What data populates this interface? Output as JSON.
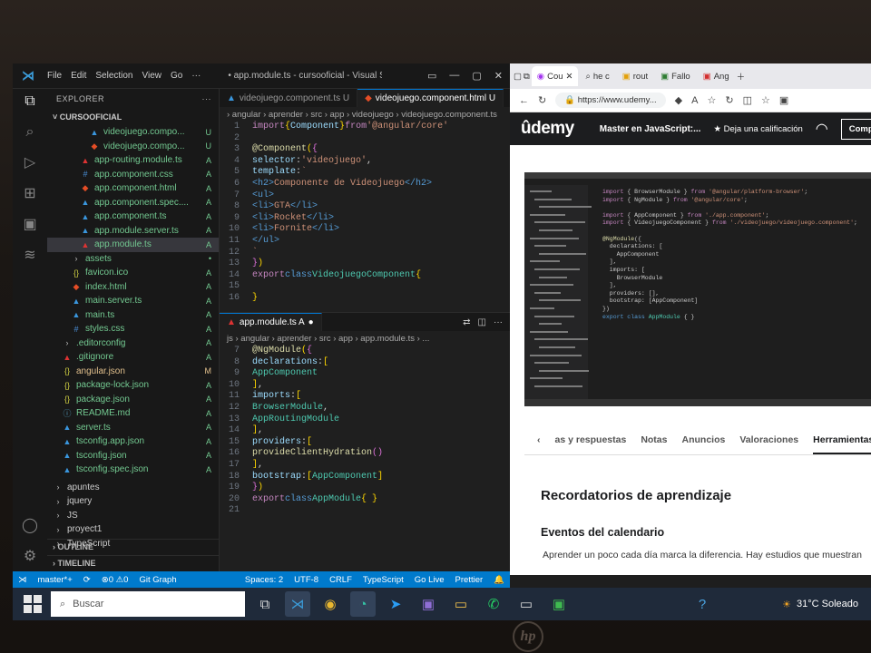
{
  "vscode": {
    "menu": [
      "File",
      "Edit",
      "Selection",
      "View",
      "Go",
      "···"
    ],
    "window_title": "• app.module.ts - cursooficial - Visual Stu...",
    "explorer_label": "EXPLORER",
    "project": "CURSOOFICIAL",
    "files": [
      {
        "name": "videojuego.compo...",
        "status": "U",
        "type": "ts",
        "indent": 2
      },
      {
        "name": "videojuego.compo...",
        "status": "U",
        "type": "html",
        "indent": 2
      },
      {
        "name": "app-routing.module.ts",
        "status": "A",
        "type": "ng",
        "indent": 1
      },
      {
        "name": "app.component.css",
        "status": "A",
        "type": "css",
        "indent": 1
      },
      {
        "name": "app.component.html",
        "status": "A",
        "type": "html",
        "indent": 1
      },
      {
        "name": "app.component.spec....",
        "status": "A",
        "type": "ts",
        "indent": 1
      },
      {
        "name": "app.component.ts",
        "status": "A",
        "type": "ts",
        "indent": 1
      },
      {
        "name": "app.module.server.ts",
        "status": "A",
        "type": "ts",
        "indent": 1
      },
      {
        "name": "app.module.ts",
        "status": "A",
        "type": "ng",
        "indent": 1,
        "selected": true
      },
      {
        "name": "assets",
        "status": "•",
        "type": "dir",
        "indent": 0
      },
      {
        "name": "favicon.ico",
        "status": "A",
        "type": "json",
        "indent": 0
      },
      {
        "name": "index.html",
        "status": "A",
        "type": "html",
        "indent": 0
      },
      {
        "name": "main.server.ts",
        "status": "A",
        "type": "ts",
        "indent": 0
      },
      {
        "name": "main.ts",
        "status": "A",
        "type": "ts",
        "indent": 0
      },
      {
        "name": "styles.css",
        "status": "A",
        "type": "css",
        "indent": 0
      },
      {
        "name": ".editorconfig",
        "status": "A",
        "type": "dir",
        "indent": -1
      },
      {
        "name": ".gitignore",
        "status": "A",
        "type": "ng",
        "indent": -1
      },
      {
        "name": "angular.json",
        "status": "M",
        "type": "json",
        "indent": -1
      },
      {
        "name": "package-lock.json",
        "status": "A",
        "type": "json",
        "indent": -1
      },
      {
        "name": "package.json",
        "status": "A",
        "type": "json",
        "indent": -1
      },
      {
        "name": "README.md",
        "status": "A",
        "type": "md",
        "indent": -1
      },
      {
        "name": "server.ts",
        "status": "A",
        "type": "ts",
        "indent": -1
      },
      {
        "name": "tsconfig.app.json",
        "status": "A",
        "type": "ts",
        "indent": -1
      },
      {
        "name": "tsconfig.json",
        "status": "A",
        "type": "ts",
        "indent": -1
      },
      {
        "name": "tsconfig.spec.json",
        "status": "A",
        "type": "ts",
        "indent": -1
      }
    ],
    "folders": [
      "apuntes",
      "jquery",
      "JS",
      "proyect1",
      "TypeScript"
    ],
    "outline_label": "OUTLINE",
    "timeline_label": "TIMELINE",
    "tab1": "videojuego.component.ts U",
    "tab2": "videojuego.component.html U",
    "crumb1": "› angular › aprender › src › app › videojuego › videojuego.component.ts",
    "pane2_tab": "app.module.ts A",
    "crumb2": "js › angular › aprender › src › app › app.module.ts › ...",
    "status": {
      "branch": "master*+",
      "errors": "⊗0 ⚠0",
      "git": "Git Graph",
      "spaces": "Spaces: 2",
      "enc": "UTF-8",
      "eol": "CRLF",
      "lang": "TypeScript",
      "golive": "Go Live",
      "prettier": "Prettier"
    }
  },
  "browser": {
    "tabs": [
      "Cou",
      "he c",
      "rout",
      "Fallo",
      "Ang"
    ],
    "url": "https://www.udemy...",
    "udemy_logo": "ûdemy",
    "course": "Master en JavaScript:...",
    "rate": "Deja una calificación",
    "share": "Compartir",
    "nav_tabs": [
      "as y respuestas",
      "Notas",
      "Anuncios",
      "Valoraciones",
      "Herramientas"
    ],
    "h1": "Recordatorios de aprendizaje",
    "h2": "Eventos del calendario",
    "p": "Aprender un poco cada día marca la diferencia. Hay estudios que muestran"
  },
  "taskbar": {
    "search": "Buscar",
    "weather": "31°C  Soleado"
  },
  "bezel_logo": "hp"
}
